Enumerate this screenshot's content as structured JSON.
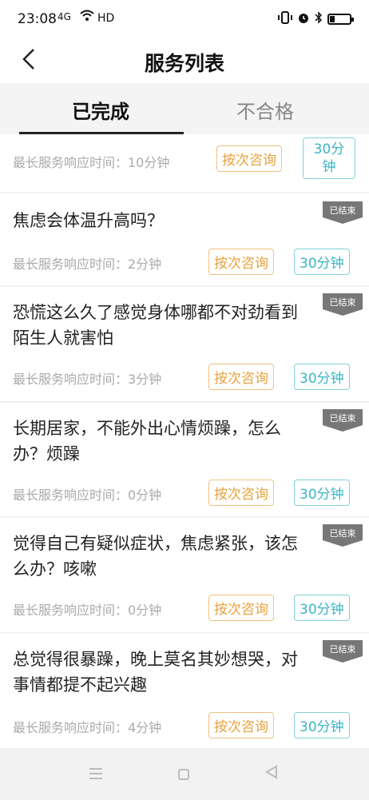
{
  "status_bar": {
    "time": "23:08",
    "signal": "4G",
    "network": "HD"
  },
  "header": {
    "title": "服务列表"
  },
  "tabs": [
    {
      "label": "已完成",
      "active": true
    },
    {
      "label": "不合格",
      "active": false
    }
  ],
  "cards": [
    {
      "title": "",
      "meta": "最长服务响应时间：10分钟",
      "consult_label": "按次咨询",
      "duration_label": "30分钟",
      "badge": ""
    },
    {
      "title": "焦虑会体温升高吗？",
      "meta": "最长服务响应时间：2分钟",
      "consult_label": "按次咨询",
      "duration_label": "30分钟",
      "badge": "已结束"
    },
    {
      "title": "恐慌这么久了感觉身体哪都不对劲看到陌生人就害怕",
      "meta": "最长服务响应时间：3分钟",
      "consult_label": "按次咨询",
      "duration_label": "30分钟",
      "badge": "已结束"
    },
    {
      "title": "长期居家，不能外出心情烦躁，怎么办？烦躁",
      "meta": "最长服务响应时间：0分钟",
      "consult_label": "按次咨询",
      "duration_label": "30分钟",
      "badge": "已结束"
    },
    {
      "title": "觉得自己有疑似症状，焦虑紧张，该怎么办？咳嗽",
      "meta": "最长服务响应时间：0分钟",
      "consult_label": "按次咨询",
      "duration_label": "30分钟",
      "badge": "已结束"
    },
    {
      "title": "总觉得很暴躁，晚上莫名其妙想哭，对事情都提不起兴趣",
      "meta": "最长服务响应时间：4分钟",
      "consult_label": "按次咨询",
      "duration_label": "30分钟",
      "badge": "已结束"
    }
  ],
  "colors": {
    "consult_tag": "#e8a13c",
    "duration_tag": "#3bb5c5",
    "badge_bg": "#777777"
  }
}
